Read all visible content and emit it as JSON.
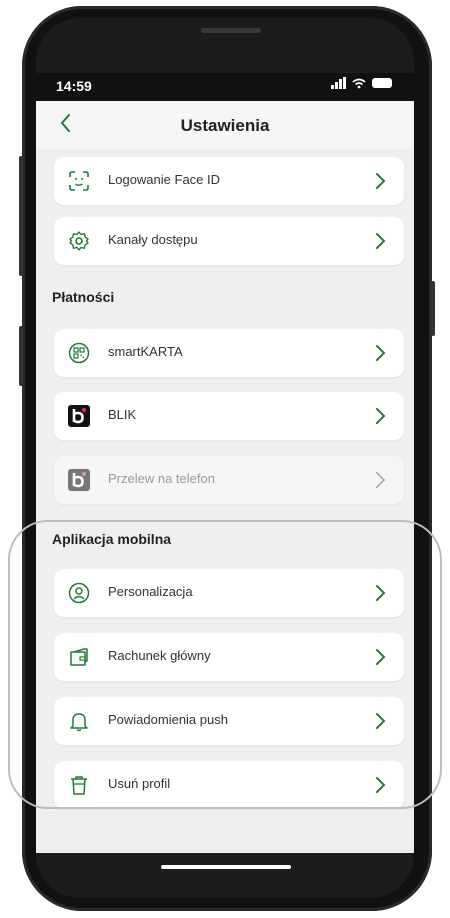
{
  "status": {
    "time": "14:59"
  },
  "header": {
    "title": "Ustawienia"
  },
  "sections": {
    "payments": "Płatności",
    "mobile_app": "Aplikacja mobilna"
  },
  "items": [
    {
      "label": "Logowanie Face ID",
      "icon": "face-id-icon"
    },
    {
      "label": "Kanały dostępu",
      "icon": "gear-icon"
    },
    {
      "label": "smartKARTA",
      "icon": "qr-code-icon"
    },
    {
      "label": "BLIK",
      "icon": "blik-logo-icon"
    },
    {
      "label": "Przelew na telefon",
      "icon": "blik-logo-icon"
    },
    {
      "label": "Personalizacja",
      "icon": "user-icon"
    },
    {
      "label": "Rachunek główny",
      "icon": "wallet-icon"
    },
    {
      "label": "Powiadomienia push",
      "icon": "bell-icon"
    },
    {
      "label": "Usuń profil",
      "icon": "trash-icon"
    }
  ],
  "colors": {
    "accent": "#1f7a3a",
    "background": "#efefef",
    "card": "#ffffff"
  }
}
